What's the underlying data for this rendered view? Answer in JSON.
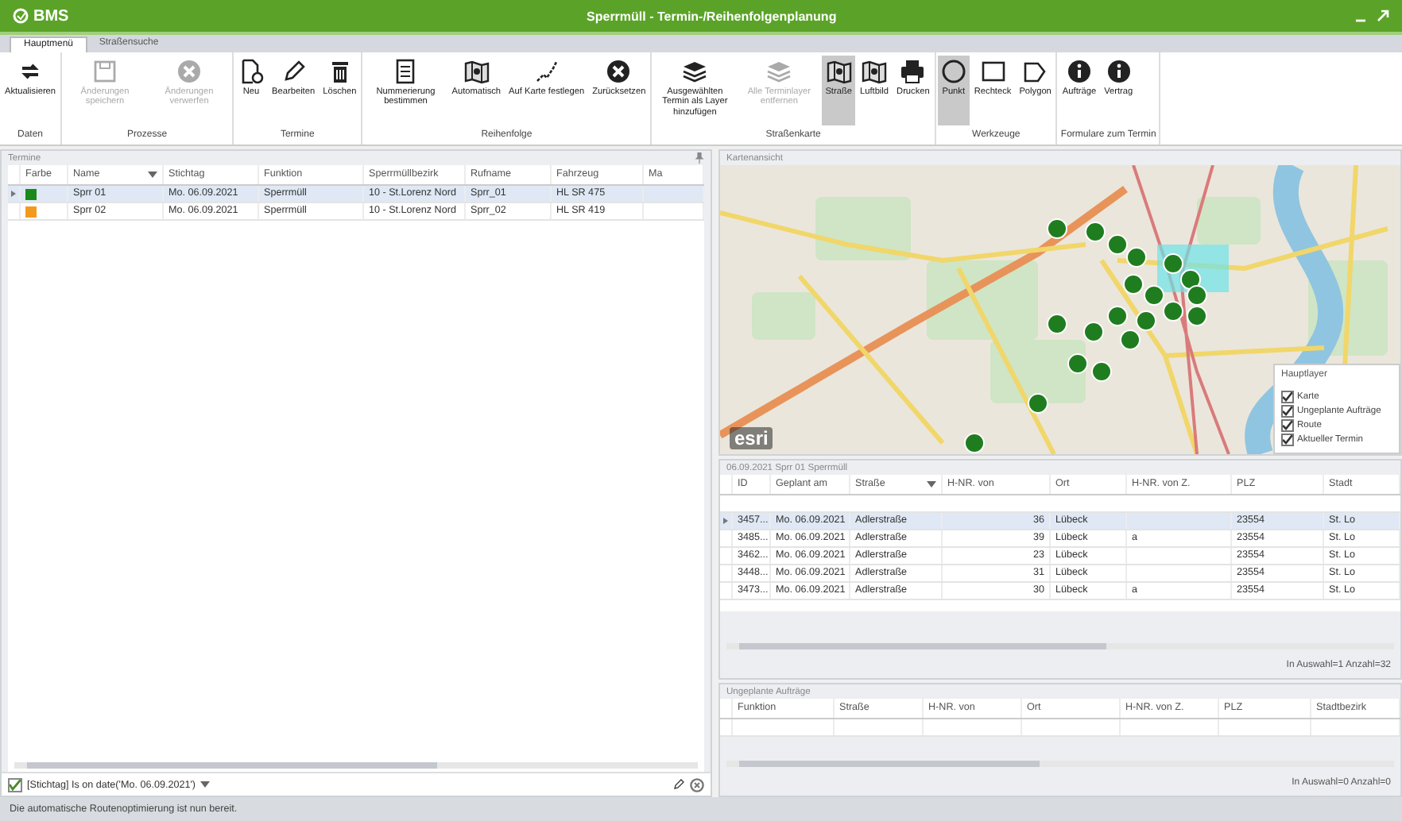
{
  "window": {
    "logo": "BMS",
    "title": "Sperrmüll - Termin-/Reihenfolgenplanung"
  },
  "tabs": [
    {
      "label": "Hauptmenü",
      "selected": true
    },
    {
      "label": "Straßensuche",
      "selected": false
    }
  ],
  "ribbon": {
    "groups": [
      {
        "label": "Daten",
        "buttons": [
          {
            "label": "Aktualisieren",
            "disabled": false,
            "selected": false
          }
        ]
      },
      {
        "label": "Prozesse",
        "buttons": [
          {
            "label": "Änderungen speichern",
            "disabled": true,
            "selected": false
          },
          {
            "label": "Änderungen verwerfen",
            "disabled": true,
            "selected": false
          }
        ]
      },
      {
        "label": "Termine",
        "buttons": [
          {
            "label": "Neu",
            "disabled": false,
            "selected": false
          },
          {
            "label": "Bearbeiten",
            "disabled": false,
            "selected": false
          },
          {
            "label": "Löschen",
            "disabled": false,
            "selected": false
          }
        ]
      },
      {
        "label": "Reihenfolge",
        "buttons": [
          {
            "label": "Nummerierung bestimmen",
            "disabled": false,
            "selected": false
          },
          {
            "label": "Automatisch",
            "disabled": false,
            "selected": false
          },
          {
            "label": "Auf Karte festlegen",
            "disabled": false,
            "selected": false
          },
          {
            "label": "Zurücksetzen",
            "disabled": false,
            "selected": false
          }
        ]
      },
      {
        "label": "Straßenkarte",
        "buttons": [
          {
            "label": "Ausgewählten Termin als Layer hinzufügen",
            "disabled": false,
            "selected": false
          },
          {
            "label": "Alle Terminlayer entfernen",
            "disabled": true,
            "selected": false
          },
          {
            "label": "Straße",
            "disabled": false,
            "selected": true
          },
          {
            "label": "Luftbild",
            "disabled": false,
            "selected": false
          },
          {
            "label": "Drucken",
            "disabled": false,
            "selected": false
          }
        ]
      },
      {
        "label": "Werkzeuge",
        "buttons": [
          {
            "label": "Punkt",
            "disabled": false,
            "selected": true
          },
          {
            "label": "Rechteck",
            "disabled": false,
            "selected": false
          },
          {
            "label": "Polygon",
            "disabled": false,
            "selected": false
          }
        ]
      },
      {
        "label": "Formulare zum Termin",
        "buttons": [
          {
            "label": "Aufträge",
            "disabled": false,
            "selected": false
          },
          {
            "label": "Vertrag",
            "disabled": false,
            "selected": false
          }
        ]
      }
    ]
  },
  "termine": {
    "title": "Termine",
    "columns": [
      {
        "label": "Farbe",
        "sorted": false
      },
      {
        "label": "Name",
        "sorted": true
      },
      {
        "label": "Stichtag",
        "sorted": false
      },
      {
        "label": "Funktion",
        "sorted": false
      },
      {
        "label": "Sperrmüllbezirk",
        "sorted": false
      },
      {
        "label": "Rufname",
        "sorted": false
      },
      {
        "label": "Fahrzeug",
        "sorted": false
      },
      {
        "label": "Ma",
        "sorted": false
      }
    ],
    "rows": [
      {
        "selected": true,
        "color": "#1a8a1a",
        "cells": [
          "",
          "Sprr 01",
          "Mo. 06.09.2021",
          "Sperrmüll",
          "10 - St.Lorenz Nord",
          "Sprr_01",
          "HL SR 475",
          null
        ]
      },
      {
        "selected": false,
        "color": "#f29a1d",
        "cells": [
          "",
          "Sprr 02",
          "Mo. 06.09.2021",
          "Sperrmüll",
          "10 - St.Lorenz Nord",
          "Sprr_02",
          "HL SR 419",
          null
        ]
      }
    ],
    "filter": {
      "enabled": true,
      "text": "[Stichtag] Is on date('Mo. 06.09.2021')"
    }
  },
  "map": {
    "title": "Kartenansicht",
    "attribution": "esri",
    "legend": {
      "title": "Hauptlayer",
      "items": [
        {
          "label": "Karte",
          "checked": true
        },
        {
          "label": "Ungeplante Aufträge",
          "checked": true
        },
        {
          "label": "Route",
          "checked": true
        },
        {
          "label": "Aktueller Termin",
          "checked": true
        }
      ]
    }
  },
  "tour": {
    "title": "06.09.2021 Sprr 01 Sperrmüll",
    "columns": [
      {
        "label": "ID",
        "sorted": false
      },
      {
        "label": "Geplant am",
        "sorted": false
      },
      {
        "label": "Straße",
        "sorted": true
      },
      {
        "label": "H-NR. von",
        "sorted": false
      },
      {
        "label": "Ort",
        "sorted": false
      },
      {
        "label": "H-NR. von Z.",
        "sorted": false
      },
      {
        "label": "PLZ",
        "sorted": false
      },
      {
        "label": "Stadt",
        "sorted": false
      }
    ],
    "rows": [
      {
        "selected": true,
        "cells": [
          "3457...",
          "Mo. 06.09.2021",
          "Adlerstraße",
          "36",
          "Lübeck",
          null,
          "23554",
          "St. Lo"
        ]
      },
      {
        "selected": false,
        "cells": [
          "3485...",
          "Mo. 06.09.2021",
          "Adlerstraße",
          "39",
          "Lübeck",
          "a",
          "23554",
          "St. Lo"
        ]
      },
      {
        "selected": false,
        "cells": [
          "3462...",
          "Mo. 06.09.2021",
          "Adlerstraße",
          "23",
          "Lübeck",
          null,
          "23554",
          "St. Lo"
        ]
      },
      {
        "selected": false,
        "cells": [
          "3448...",
          "Mo. 06.09.2021",
          "Adlerstraße",
          "31",
          "Lübeck",
          null,
          "23554",
          "St. Lo"
        ]
      },
      {
        "selected": false,
        "cells": [
          "3473...",
          "Mo. 06.09.2021",
          "Adlerstraße",
          "30",
          "Lübeck",
          "a",
          "23554",
          "St. Lo"
        ]
      }
    ],
    "summary": "In Auswahl=1 Anzahl=32"
  },
  "unplanned": {
    "title": "Ungeplante Aufträge",
    "columns": [
      {
        "label": "Funktion",
        "sorted": false
      },
      {
        "label": "Straße",
        "sorted": false
      },
      {
        "label": "H-NR. von",
        "sorted": false
      },
      {
        "label": "Ort",
        "sorted": false
      },
      {
        "label": "H-NR. von Z.",
        "sorted": false
      },
      {
        "label": "PLZ",
        "sorted": false
      },
      {
        "label": "Stadtbezirk",
        "sorted": false
      }
    ],
    "summary": "In Auswahl=0 Anzahl=0"
  },
  "status_bar": "Die automatische Routenoptimierung ist nun bereit."
}
